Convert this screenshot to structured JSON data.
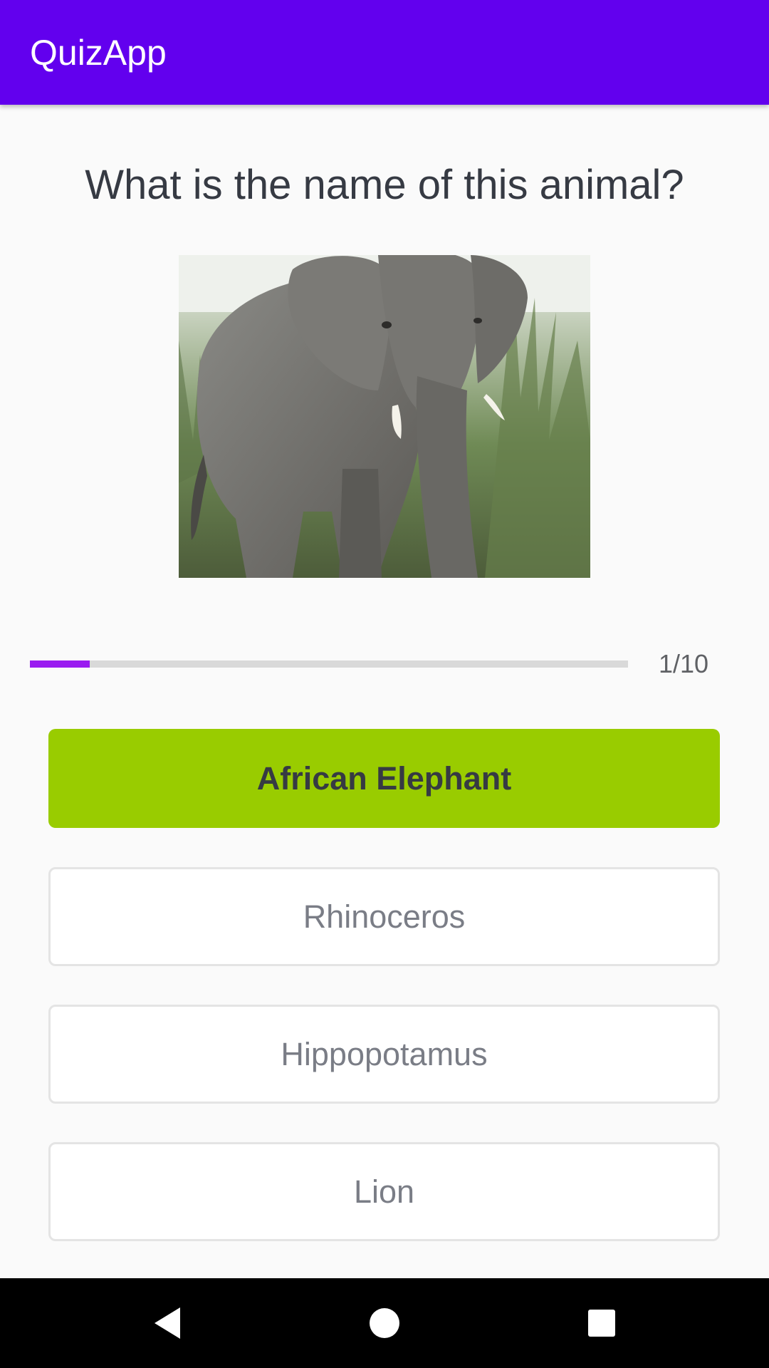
{
  "app_bar": {
    "title": "QuizApp",
    "color": "#6200ee"
  },
  "quiz": {
    "question": "What is the name of this animal?",
    "image": {
      "subject": "african-elephant-photo"
    },
    "progress": {
      "current": 1,
      "total": 10,
      "fraction": 0.1,
      "label": "1/10",
      "fill_color": "#9a1bf0"
    },
    "options": [
      {
        "label": "African Elephant",
        "state": "correct-selected",
        "color": "#99cc00"
      },
      {
        "label": "Rhinoceros",
        "state": "default"
      },
      {
        "label": "Hippopotamus",
        "state": "default"
      },
      {
        "label": "Lion",
        "state": "default"
      }
    ]
  },
  "nav_bar": {
    "buttons": [
      "back-icon",
      "home-icon",
      "recents-icon"
    ]
  }
}
